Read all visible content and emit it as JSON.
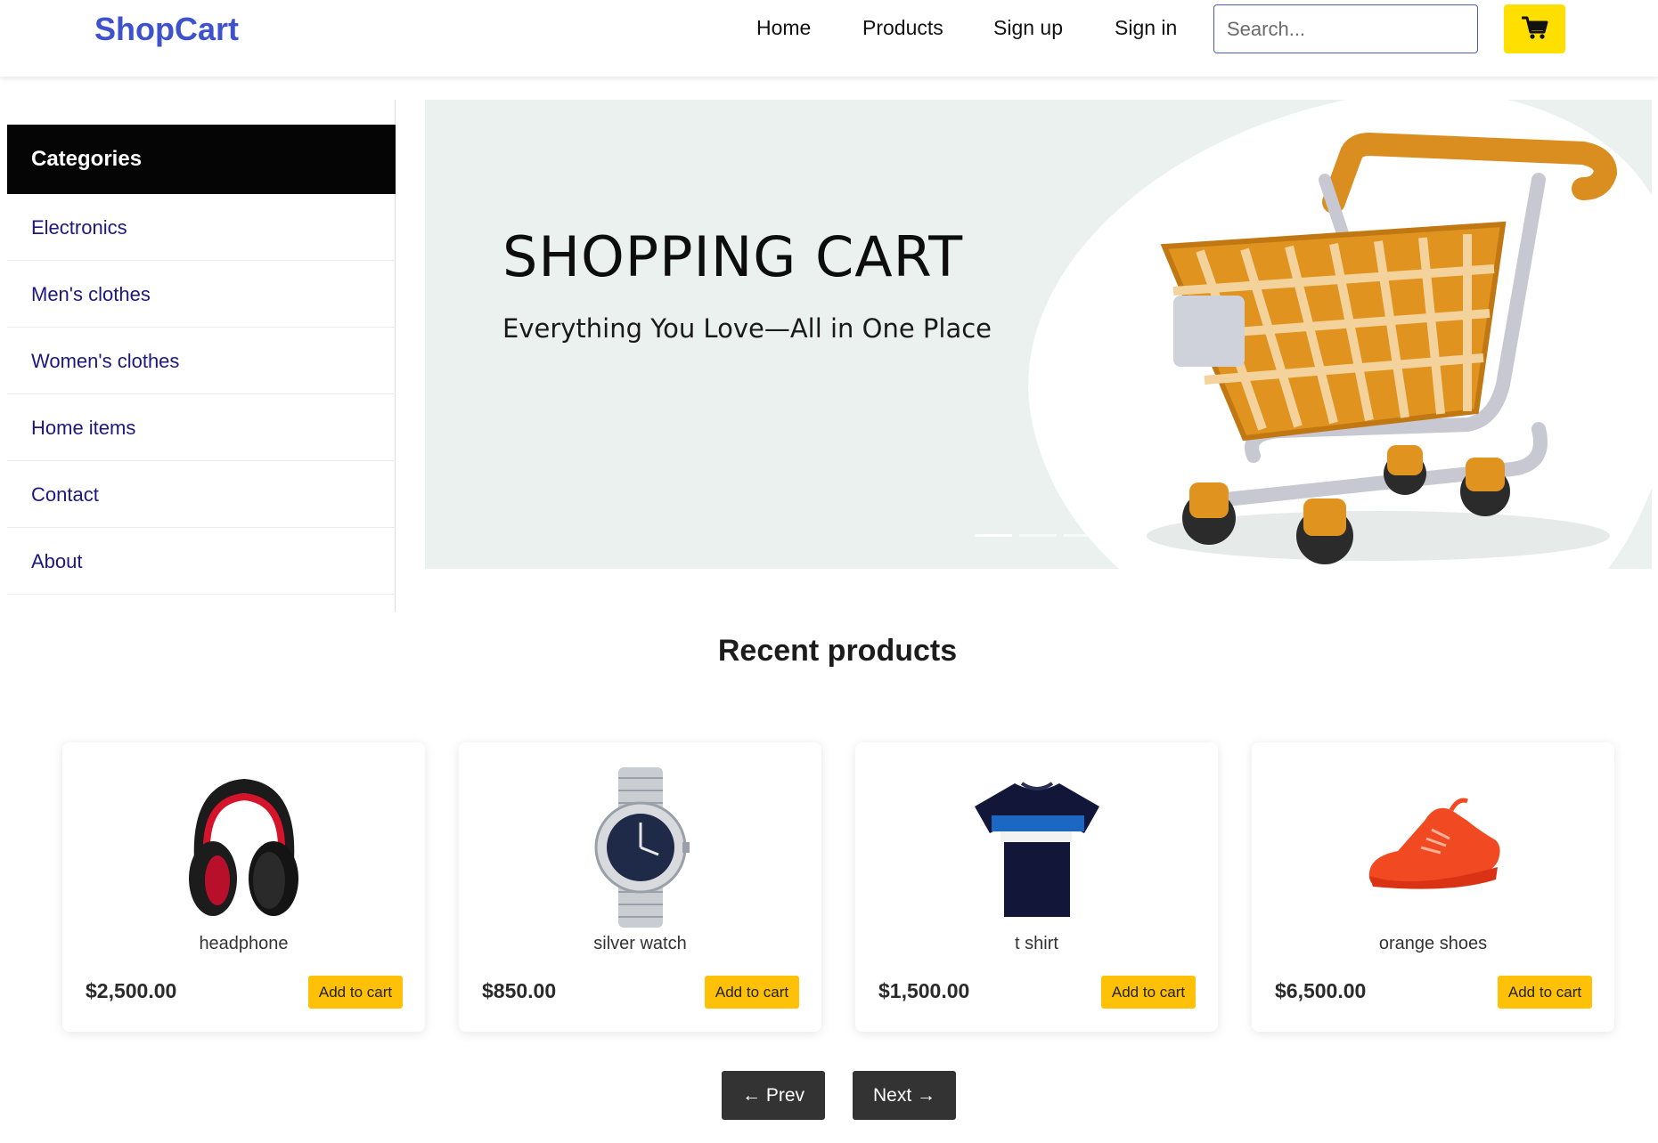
{
  "header": {
    "brand": "ShopCart",
    "nav": {
      "home": "Home",
      "products": "Products",
      "signup": "Sign up",
      "signin": "Sign in"
    },
    "search_placeholder": "Search...",
    "cart_icon": "shopping-cart-icon",
    "cart_button_color": "#ffdf00"
  },
  "sidebar": {
    "title": "Categories",
    "items": [
      {
        "label": "Electronics"
      },
      {
        "label": "Men's clothes"
      },
      {
        "label": "Women's clothes"
      },
      {
        "label": "Home items"
      },
      {
        "label": "Contact"
      },
      {
        "label": "About"
      }
    ]
  },
  "hero": {
    "title": "SHOPPING CART",
    "subtitle": "Everything You Love—All in One Place",
    "slide_count": 3,
    "active_slide": 1
  },
  "recent": {
    "title": "Recent products",
    "products": [
      {
        "name": "headphone",
        "price": "$2,500.00",
        "button": "Add to cart",
        "icon": "headphone-image"
      },
      {
        "name": "silver watch",
        "price": "$850.00",
        "button": "Add to cart",
        "icon": "watch-image"
      },
      {
        "name": "t shirt",
        "price": "$1,500.00",
        "button": "Add to cart",
        "icon": "tshirt-image"
      },
      {
        "name": "orange shoes",
        "price": "$6,500.00",
        "button": "Add to cart",
        "icon": "shoes-image"
      }
    ]
  },
  "pagination": {
    "prev": "← Prev",
    "next": "Next →"
  },
  "colors": {
    "brand": "#3d52cc",
    "accent_button": "#ffc107",
    "sidebar_header": "#050505",
    "link": "#1d1880"
  }
}
